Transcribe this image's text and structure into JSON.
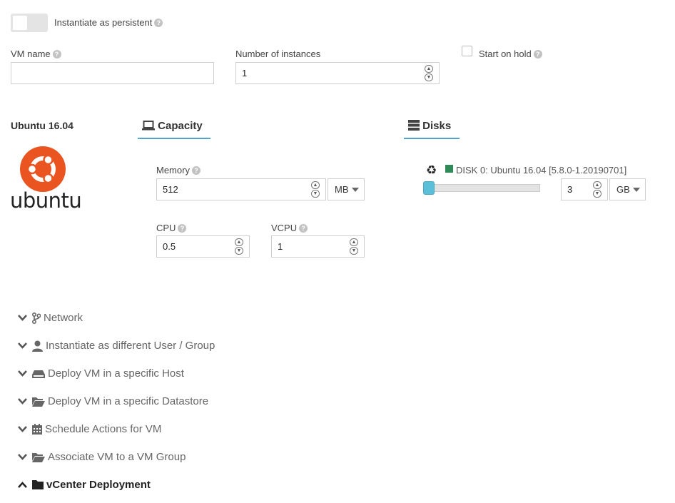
{
  "persistent": {
    "label": "Instantiate as persistent",
    "help": "?"
  },
  "vm_name": {
    "label": "VM name",
    "value": ""
  },
  "instances": {
    "label": "Number of instances",
    "value": "1"
  },
  "hold": {
    "label": "Start on hold"
  },
  "template": {
    "name": "Ubuntu 16.04",
    "logo_text": "ubuntu"
  },
  "capacity": {
    "tab_label": "Capacity",
    "memory_label": "Memory",
    "memory_value": "512",
    "memory_unit": "MB",
    "cpu_label": "CPU",
    "cpu_value": "0.5",
    "vcpu_label": "VCPU",
    "vcpu_value": "1"
  },
  "disks": {
    "tab_label": "Disks",
    "disk_label": "DISK 0: Ubuntu 16.04 [5.8.0-1.20190701]",
    "size_value": "3",
    "size_unit": "GB",
    "status_color": "#2e8b57"
  },
  "accordion": [
    {
      "label": "Network",
      "icon": "network-icon",
      "state": "collapsed"
    },
    {
      "label": "Instantiate as different User / Group",
      "icon": "user-icon",
      "state": "collapsed"
    },
    {
      "label": "Deploy VM in a specific Host",
      "icon": "host-icon",
      "state": "collapsed"
    },
    {
      "label": "Deploy VM in a specific Datastore",
      "icon": "folder-open-icon",
      "state": "collapsed"
    },
    {
      "label": "Schedule Actions for VM",
      "icon": "calendar-icon",
      "state": "collapsed"
    },
    {
      "label": "Associate VM to a VM Group",
      "icon": "folder-open-icon",
      "state": "collapsed"
    },
    {
      "label": "vCenter Deployment",
      "icon": "folder-icon",
      "state": "expanded"
    }
  ],
  "colors": {
    "accent": "#53a3c9",
    "slider": "#5bbfd9",
    "ubuntu": "#e95420"
  }
}
